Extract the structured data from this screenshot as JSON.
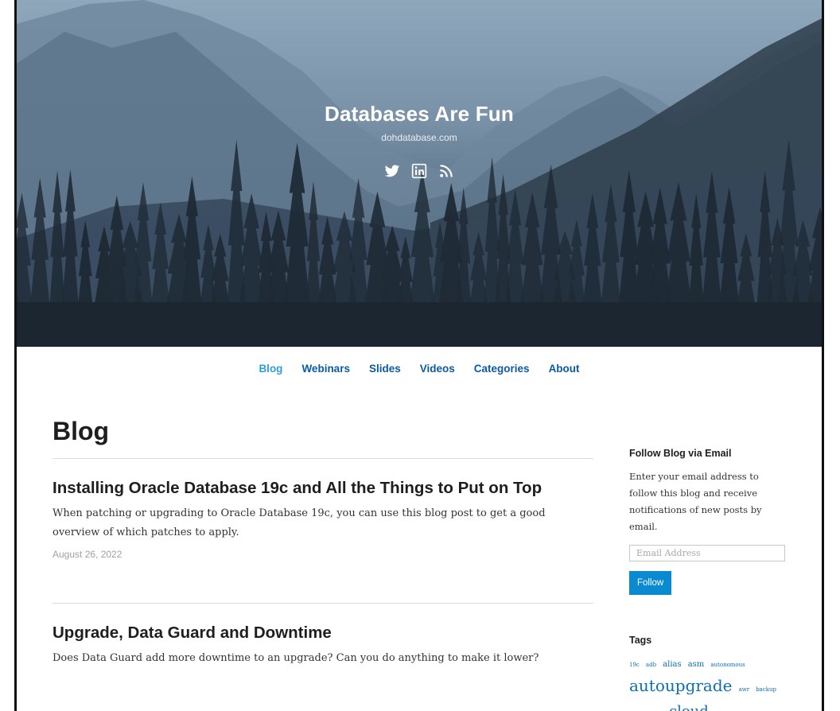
{
  "site": {
    "title": "Databases Are Fun",
    "subtitle": "dohdatabase.com"
  },
  "social": [
    {
      "name": "twitter-icon"
    },
    {
      "name": "linkedin-icon"
    },
    {
      "name": "rss-icon"
    }
  ],
  "nav": {
    "items": [
      "Blog",
      "Webinars",
      "Slides",
      "Videos",
      "Categories",
      "About"
    ],
    "active": "Blog"
  },
  "main": {
    "page_title": "Blog",
    "posts": [
      {
        "title": "Installing Oracle Database 19c and All the Things to Put on Top",
        "excerpt": "When patching or upgrading to Oracle Database 19c, you can use this blog post to get a good overview of which patches to apply.",
        "date": "August 26, 2022"
      },
      {
        "title": "Upgrade, Data Guard and Downtime",
        "excerpt": "Does Data Guard add more downtime to an upgrade? Can you do anything to make it lower?"
      }
    ]
  },
  "sidebar": {
    "follow": {
      "title": "Follow Blog via Email",
      "description": "Enter your email address to follow this blog and receive notifications of new posts by email.",
      "email_placeholder": "Email Address",
      "button_label": "Follow"
    },
    "tags": {
      "title": "Tags",
      "line1": [
        "19c",
        "adb",
        "alias",
        "asm",
        "autonomous"
      ],
      "line2_big": "autoupgrade",
      "line2_small": [
        "awr",
        "backup"
      ],
      "line3_partial": "cloud"
    }
  },
  "colors": {
    "link": "#0b5aa5",
    "active_link": "#2f9fd8",
    "button": "#0a8ad1"
  }
}
